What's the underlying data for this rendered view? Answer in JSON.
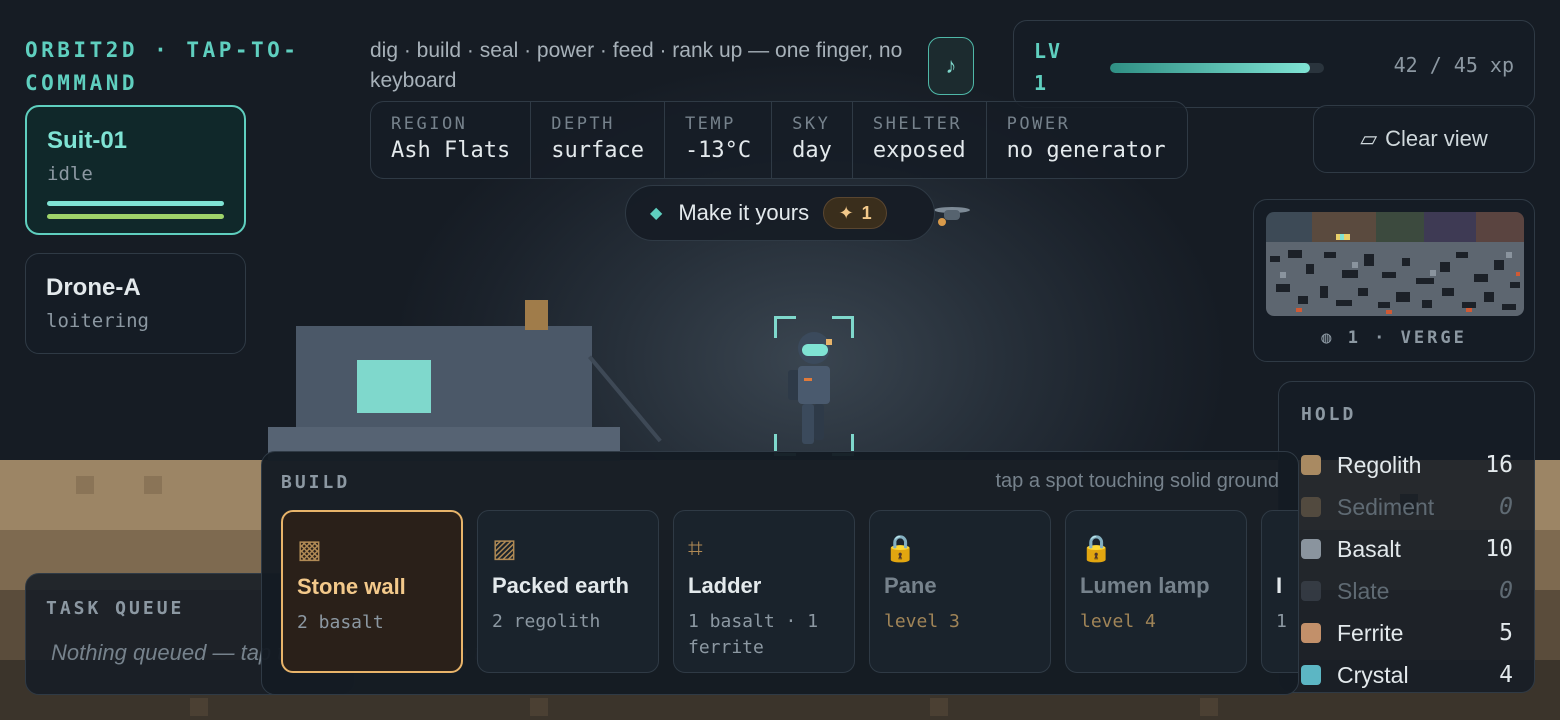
{
  "app": {
    "title": "ORBIT2D · TAP-TO-COMMAND",
    "tagline": "dig · build · seal · power · feed · rank up — one finger, no keyboard"
  },
  "music_button": {
    "icon": "music-note-icon",
    "glyph": "♪"
  },
  "level": {
    "label": "LV 1",
    "xp_text": "42 / 45 xp",
    "xp_current": 42,
    "xp_max": 45
  },
  "status": [
    {
      "label": "REGION",
      "value": "Ash Flats"
    },
    {
      "label": "DEPTH",
      "value": "surface"
    },
    {
      "label": "TEMP",
      "value": "-13°C"
    },
    {
      "label": "SKY",
      "value": "day"
    },
    {
      "label": "SHELTER",
      "value": "exposed"
    },
    {
      "label": "POWER",
      "value": "no generator"
    }
  ],
  "units": [
    {
      "name": "Suit-01",
      "state": "idle",
      "selected": true
    },
    {
      "name": "Drone-A",
      "state": "loitering",
      "selected": false
    }
  ],
  "make_it_yours": {
    "label": "Make it yours",
    "badge_glyph": "✦",
    "badge_count": "1"
  },
  "clear_view": {
    "label": "Clear view",
    "glyph": "▱"
  },
  "minimap": {
    "label": "1 · VERGE",
    "glyph": "◍"
  },
  "hold": {
    "title": "HOLD",
    "items": [
      {
        "name": "Regolith",
        "qty": "16",
        "color": "#a98a62"
      },
      {
        "name": "Sediment",
        "qty": "0",
        "color": "#8a7457"
      },
      {
        "name": "Basalt",
        "qty": "10",
        "color": "#8a949e"
      },
      {
        "name": "Slate",
        "qty": "0",
        "color": "#4d5661"
      },
      {
        "name": "Ferrite",
        "qty": "5",
        "color": "#c2906a"
      },
      {
        "name": "Crystal",
        "qty": "4",
        "color": "#5cb6c4"
      }
    ]
  },
  "task_queue": {
    "title": "TASK QUEUE",
    "empty_text": "Nothing queued — tap the ground to add a task"
  },
  "build": {
    "title": "BUILD",
    "hint": "tap a spot touching solid ground",
    "items": [
      {
        "name": "Stone wall",
        "cost": "2 basalt",
        "glyph": "▩",
        "icon": "stone-wall-icon",
        "state": "selected"
      },
      {
        "name": "Packed earth",
        "cost": "2 regolith",
        "glyph": "▨",
        "icon": "packed-earth-icon",
        "state": "available"
      },
      {
        "name": "Ladder",
        "cost": "1 basalt · 1 ferrite",
        "glyph": "⌗",
        "icon": "ladder-icon",
        "state": "available"
      },
      {
        "name": "Pane",
        "cost": "level 3",
        "glyph": "🔒",
        "icon": "lock-icon",
        "state": "locked"
      },
      {
        "name": "Lumen lamp",
        "cost": "level 4",
        "glyph": "🔒",
        "icon": "lock-icon",
        "state": "locked"
      },
      {
        "name": "I",
        "cost": "1",
        "glyph": "",
        "icon": "",
        "state": "available"
      }
    ]
  },
  "colors": {
    "accent": "#5fcfbf",
    "selected_border": "#e8b46a",
    "unit_bar_primary": "#7fe3d4",
    "unit_bar_secondary": "#9ed46a"
  }
}
